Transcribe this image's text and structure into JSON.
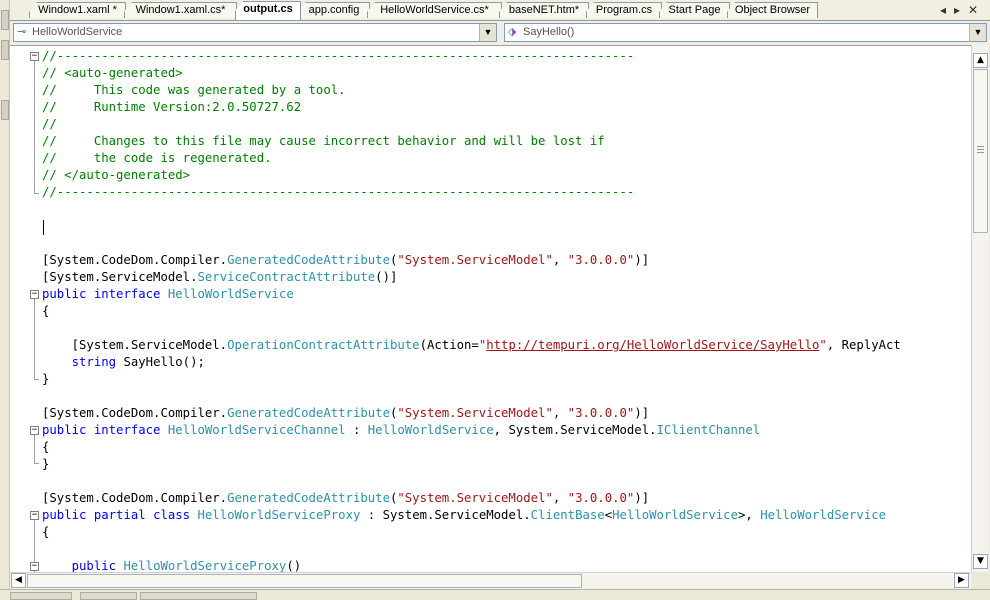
{
  "tabs": [
    {
      "label": "Window1.xaml *",
      "active": false
    },
    {
      "label": "Window1.xaml.cs*",
      "active": false
    },
    {
      "label": "output.cs",
      "active": true
    },
    {
      "label": "app.config",
      "active": false
    },
    {
      "label": "HelloWorldService.cs*",
      "active": false
    },
    {
      "label": "baseNET.htm*",
      "active": false
    },
    {
      "label": "Program.cs",
      "active": false
    },
    {
      "label": "Start Page",
      "active": false
    },
    {
      "label": "Object Browser",
      "active": false
    }
  ],
  "tab_controls": {
    "scroll_left": "◂",
    "scroll_right": "▸",
    "close": "✕"
  },
  "navigation": {
    "type_combo": {
      "value": "HelloWorldService",
      "icon": "class-icon"
    },
    "member_combo": {
      "value": "SayHello()",
      "icon": "method-icon"
    },
    "dropdown_glyph": "▼"
  },
  "code": {
    "language": "C#",
    "lines": [
      "//------------------------------------------------------------------------------",
      "// <auto-generated>",
      "//     This code was generated by a tool.",
      "//     Runtime Version:2.0.50727.62",
      "//",
      "//     Changes to this file may cause incorrect behavior and will be lost if",
      "//     the code is regenerated.",
      "// </auto-generated>",
      "//------------------------------------------------------------------------------",
      "",
      "",
      "",
      "[System.CodeDom.Compiler.GeneratedCodeAttribute(\"System.ServiceModel\", \"3.0.0.0\")]",
      "[System.ServiceModel.ServiceContractAttribute()]",
      "public interface HelloWorldService",
      "{",
      "",
      "    [System.ServiceModel.OperationContractAttribute(Action=\"http://tempuri.org/HelloWorldService/SayHello\", ReplyAct",
      "    string SayHello();",
      "}",
      "",
      "[System.CodeDom.Compiler.GeneratedCodeAttribute(\"System.ServiceModel\", \"3.0.0.0\")]",
      "public interface HelloWorldServiceChannel : HelloWorldService, System.ServiceModel.IClientChannel",
      "{",
      "}",
      "",
      "[System.CodeDom.Compiler.GeneratedCodeAttribute(\"System.ServiceModel\", \"3.0.0.0\")]",
      "public partial class HelloWorldServiceProxy : System.ServiceModel.ClientBase<HelloWorldService>, HelloWorldService",
      "{",
      "",
      "    public HelloWorldServiceProxy()"
    ]
  },
  "scrollbars": {
    "vertical": {
      "up": "▲",
      "down": "▼",
      "position": 0.0,
      "visible_fraction": 0.36
    },
    "horizontal": {
      "left": "◀",
      "right": "▶",
      "position": 0.0,
      "visible_fraction": 0.6
    }
  },
  "colors": {
    "comment": "#008000",
    "keyword": "#0000ff",
    "type": "#2b91af",
    "string": "#a31515"
  }
}
